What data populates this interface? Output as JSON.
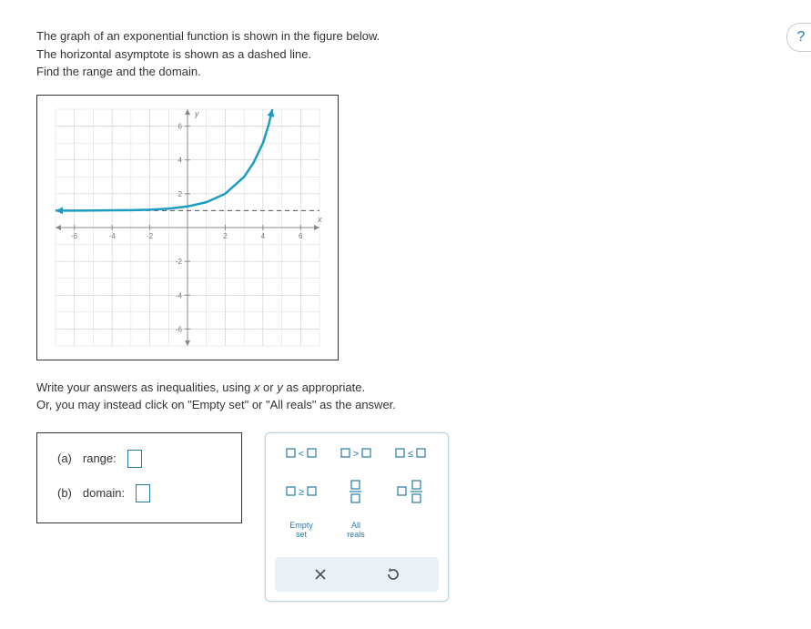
{
  "problem": {
    "line1": "The graph of an exponential function is shown in the figure below.",
    "line2": "The horizontal asymptote is shown as a dashed line.",
    "line3": "Find the range and the domain."
  },
  "chart_data": {
    "type": "line",
    "title": "",
    "xlabel": "x",
    "ylabel": "y",
    "xlim": [
      -7,
      7
    ],
    "ylim": [
      -7,
      7
    ],
    "xticks": [
      -6,
      -4,
      -2,
      2,
      4,
      6
    ],
    "yticks": [
      -6,
      -4,
      -2,
      2,
      4,
      6
    ],
    "asymptote": {
      "axis": "y",
      "value": 1,
      "style": "dashed"
    },
    "series": [
      {
        "name": "exponential",
        "x": [
          -7,
          -6,
          -5,
          -4,
          -3,
          -2,
          -1,
          0,
          1,
          2,
          3,
          3.5,
          4,
          4.3,
          4.5
        ],
        "y": [
          1.0,
          1.0,
          1.01,
          1.02,
          1.03,
          1.06,
          1.12,
          1.25,
          1.5,
          2.0,
          3.0,
          3.83,
          5.0,
          6.06,
          7.0
        ]
      }
    ]
  },
  "instructions": {
    "line1_pre": "Write your answers as inequalities, using ",
    "var1": "x",
    "line1_mid": " or ",
    "var2": "y",
    "line1_post": " as appropriate.",
    "line2": "Or, you may instead click on \"Empty set\" or \"All reals\" as the answer."
  },
  "answers": {
    "a_label": "(a)",
    "a_text": "range:",
    "b_label": "(b)",
    "b_text": "domain:"
  },
  "palette": {
    "lt": "<",
    "gt": ">",
    "le": "≤",
    "ge": "≥",
    "empty_l1": "Empty",
    "empty_l2": "set",
    "reals_l1": "All",
    "reals_l2": "reals"
  },
  "help_label": "?"
}
